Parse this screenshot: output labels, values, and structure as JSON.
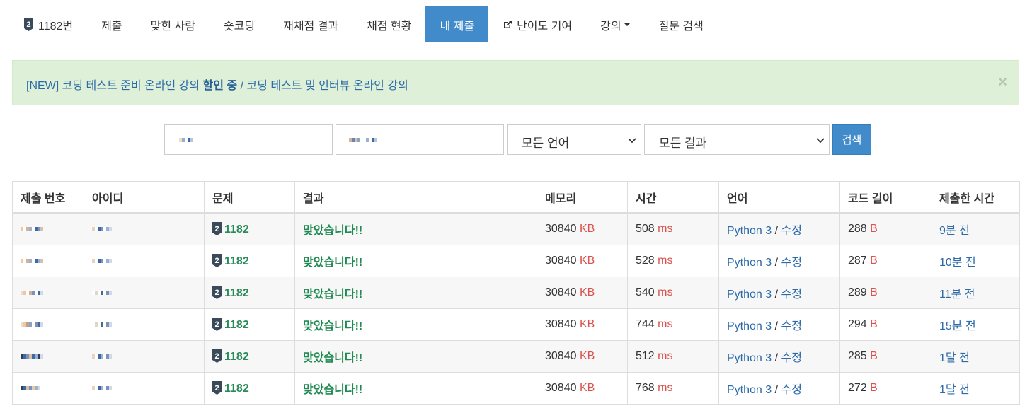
{
  "nav": {
    "problem_number": "1182번",
    "items": [
      "제출",
      "맞힌 사람",
      "숏코딩",
      "재채점 결과",
      "채점 현황",
      "내 제출",
      "난이도 기여",
      "강의",
      "질문 검색"
    ],
    "active_index": 5
  },
  "alert": {
    "prefix": "[NEW] 코딩 테스트 준비 온라인 강의 ",
    "highlight": "할인 중",
    "separator": " / ",
    "suffix": "코딩 테스트 및 인터뷰 온라인 강의",
    "close": "×"
  },
  "search": {
    "language": "모든 언어",
    "result": "모든 결과",
    "button": "검색"
  },
  "table": {
    "headers": [
      "제출 번호",
      "아이디",
      "문제",
      "결과",
      "메모리",
      "시간",
      "언어",
      "코드 길이",
      "제출한 시간"
    ],
    "rows": [
      {
        "problem": "1182",
        "result": "맞았습니다!!",
        "memory": "30840",
        "memory_unit": "KB",
        "time": "508",
        "time_unit": "ms",
        "language": "Python 3",
        "edit": "수정",
        "code_length": "288",
        "length_unit": "B",
        "submitted": "9분 전"
      },
      {
        "problem": "1182",
        "result": "맞았습니다!!",
        "memory": "30840",
        "memory_unit": "KB",
        "time": "528",
        "time_unit": "ms",
        "language": "Python 3",
        "edit": "수정",
        "code_length": "287",
        "length_unit": "B",
        "submitted": "10분 전"
      },
      {
        "problem": "1182",
        "result": "맞았습니다!!",
        "memory": "30840",
        "memory_unit": "KB",
        "time": "540",
        "time_unit": "ms",
        "language": "Python 3",
        "edit": "수정",
        "code_length": "289",
        "length_unit": "B",
        "submitted": "11분 전"
      },
      {
        "problem": "1182",
        "result": "맞았습니다!!",
        "memory": "30840",
        "memory_unit": "KB",
        "time": "744",
        "time_unit": "ms",
        "language": "Python 3",
        "edit": "수정",
        "code_length": "294",
        "length_unit": "B",
        "submitted": "15분 전"
      },
      {
        "problem": "1182",
        "result": "맞았습니다!!",
        "memory": "30840",
        "memory_unit": "KB",
        "time": "512",
        "time_unit": "ms",
        "language": "Python 3",
        "edit": "수정",
        "code_length": "285",
        "length_unit": "B",
        "submitted": "1달 전"
      },
      {
        "problem": "1182",
        "result": "맞았습니다!!",
        "memory": "30840",
        "memory_unit": "KB",
        "time": "768",
        "time_unit": "ms",
        "language": "Python 3",
        "edit": "수정",
        "code_length": "272",
        "length_unit": "B",
        "submitted": "1달 전"
      }
    ]
  },
  "colors": {
    "primary": "#428bca",
    "success_text": "#1f8a52",
    "unit_red": "#d9534f",
    "link_blue": "#2c6aa8",
    "alert_bg": "#dff0d8"
  },
  "icons": {
    "problem_badge": "shield-tier-icon",
    "external_link": "external-link-icon",
    "dropdown": "caret-down-icon",
    "close": "close-icon"
  }
}
